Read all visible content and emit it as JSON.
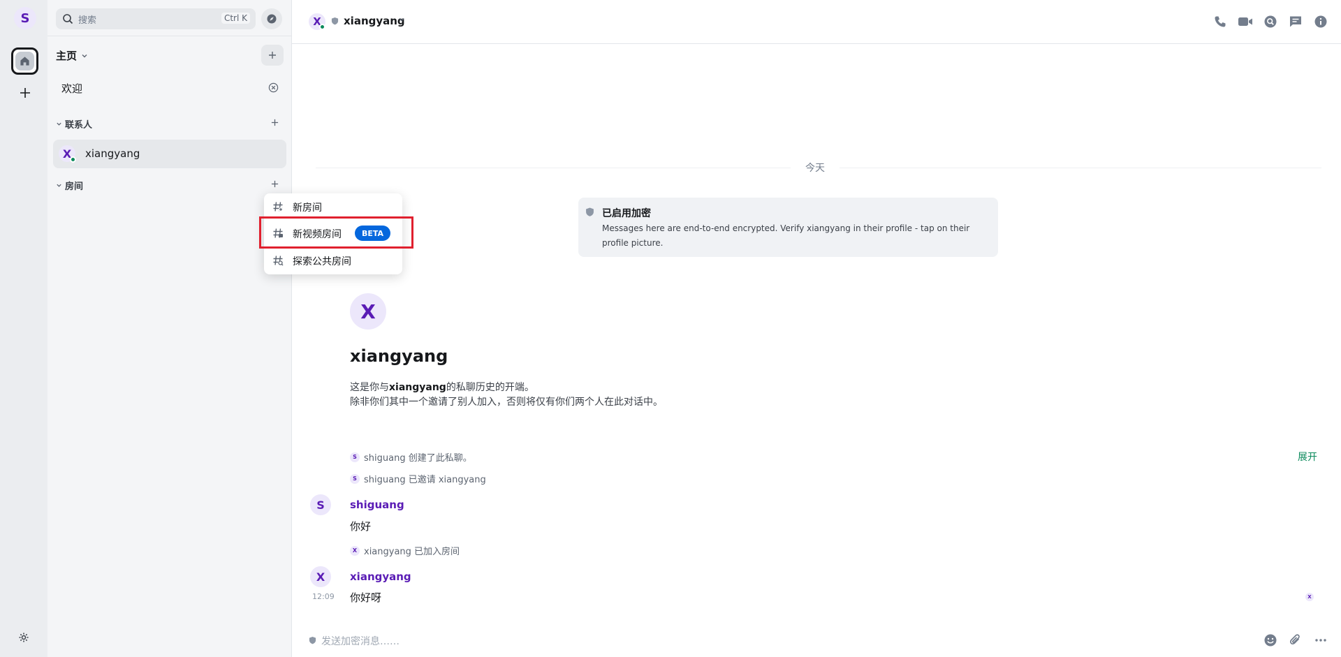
{
  "spacebar": {
    "avatar_letter": "S"
  },
  "roomlist": {
    "search_placeholder": "搜索",
    "search_shortcut": "Ctrl K",
    "home_title": "主页",
    "welcome": "欢迎",
    "contacts_header": "联系人",
    "rooms_header": "房间",
    "contact": {
      "letter": "X",
      "name": "xiangyang"
    }
  },
  "menu": {
    "items": [
      {
        "label": "新房间"
      },
      {
        "label": "新视频房间",
        "badge": "BETA"
      },
      {
        "label": "探索公共房间"
      }
    ]
  },
  "header": {
    "avatar_letter": "X",
    "room_name": "xiangyang"
  },
  "timeline": {
    "date_separator": "今天",
    "encryption": {
      "title": "已启用加密",
      "text": "Messages here are end-to-end encrypted. Verify xiangyang in their profile - tap on their profile picture."
    },
    "intro": {
      "avatar_letter": "X",
      "name": "xiangyang",
      "line1_prefix": "这是你与",
      "line1_bold": "xiangyang",
      "line1_suffix": "的私聊历史的开端。",
      "line2": "除非你们其中一个邀请了别人加入，否则将仅有你们两个人在此对话中。"
    },
    "events": [
      {
        "avatar": "S",
        "text": "shiguang 创建了此私聊。"
      },
      {
        "avatar": "S",
        "text": "shiguang 已邀请 xiangyang"
      },
      {
        "avatar": "X",
        "text": "xiangyang 已加入房间"
      }
    ],
    "expand_label": "展开",
    "messages": [
      {
        "avatar": "S",
        "sender": "shiguang",
        "body": "你好"
      },
      {
        "avatar": "X",
        "sender": "xiangyang",
        "body": "你好呀",
        "time": "12:09",
        "receipt": "X"
      }
    ]
  },
  "composer": {
    "placeholder": "发送加密消息……"
  },
  "colors": {
    "accent_purple": "#5a1cb5",
    "presence_green": "#0c8a5c",
    "beta_blue": "#0467dd",
    "highlight_red": "#e0202e"
  }
}
